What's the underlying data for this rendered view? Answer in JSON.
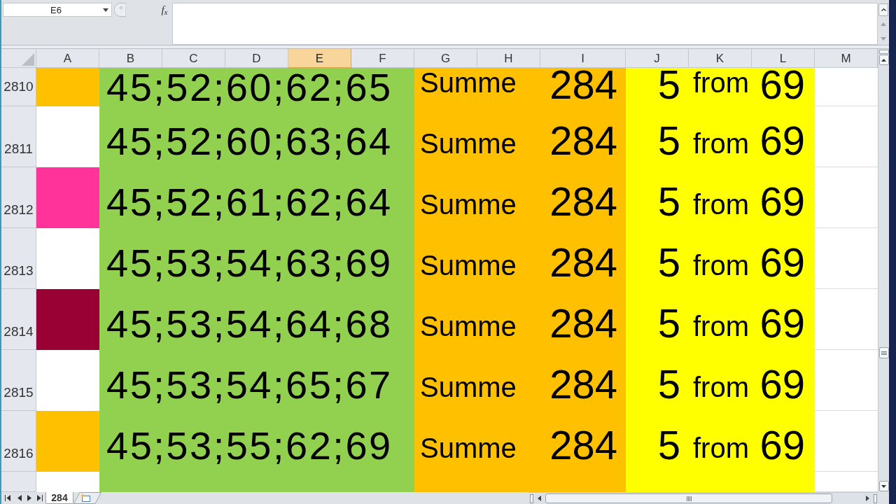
{
  "name_box": {
    "value": "E6"
  },
  "formula_bar": {
    "function_label": "f$_{x}$"
  },
  "columns": [
    {
      "label": "A",
      "selected": false
    },
    {
      "label": "B",
      "selected": false
    },
    {
      "label": "C",
      "selected": false
    },
    {
      "label": "D",
      "selected": false
    },
    {
      "label": "E",
      "selected": true
    },
    {
      "label": "F",
      "selected": false
    },
    {
      "label": "G",
      "selected": false
    },
    {
      "label": "H",
      "selected": false
    },
    {
      "label": "I",
      "selected": false
    },
    {
      "label": "J",
      "selected": false
    },
    {
      "label": "K",
      "selected": false
    },
    {
      "label": "L",
      "selected": false
    },
    {
      "label": "M",
      "selected": false
    }
  ],
  "rows": [
    {
      "header": "2810",
      "color": "#ffc000",
      "numbers": "45;52;60;62;65",
      "sum_label": "Summe",
      "sum": "284",
      "count": "5",
      "from_label": "from",
      "max": "69"
    },
    {
      "header": "2811",
      "color": "#ffffff",
      "numbers": "45;52;60;63;64",
      "sum_label": "Summe",
      "sum": "284",
      "count": "5",
      "from_label": "from",
      "max": "69"
    },
    {
      "header": "2812",
      "color": "#ff3399",
      "numbers": "45;52;61;62;64",
      "sum_label": "Summe",
      "sum": "284",
      "count": "5",
      "from_label": "from",
      "max": "69"
    },
    {
      "header": "2813",
      "color": "#ffffff",
      "numbers": "45;53;54;63;69",
      "sum_label": "Summe",
      "sum": "284",
      "count": "5",
      "from_label": "from",
      "max": "69"
    },
    {
      "header": "2814",
      "color": "#990033",
      "numbers": "45;53;54;64;68",
      "sum_label": "Summe",
      "sum": "284",
      "count": "5",
      "from_label": "from",
      "max": "69"
    },
    {
      "header": "2815",
      "color": "#ffffff",
      "numbers": "45;53;54;65;67",
      "sum_label": "Summe",
      "sum": "284",
      "count": "5",
      "from_label": "from",
      "max": "69"
    },
    {
      "header": "2816",
      "color": "#ffc000",
      "numbers": "45;53;55;62;69",
      "sum_label": "Summe",
      "sum": "284",
      "count": "5",
      "from_label": "from",
      "max": "69"
    },
    {
      "color": "#ffffff"
    }
  ],
  "sheet_tabs": [
    {
      "label": "284",
      "selected": true
    }
  ]
}
